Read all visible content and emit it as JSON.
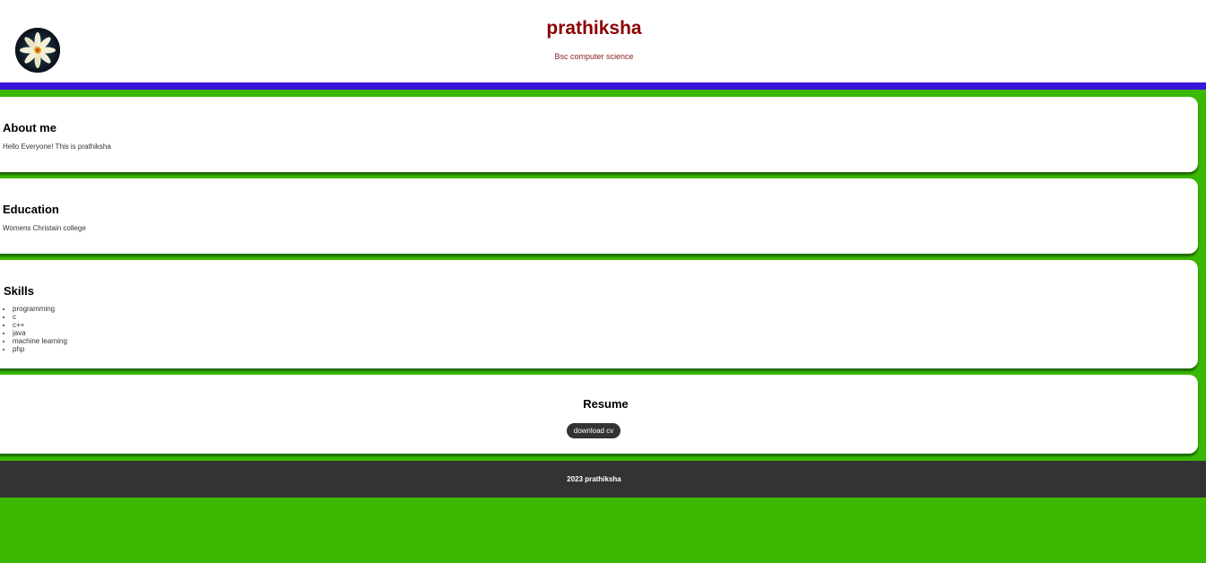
{
  "header": {
    "name": "prathiksha",
    "subtitle": "Bsc computer science",
    "avatar_icon": "white-lotus-flower-icon"
  },
  "sections": {
    "about": {
      "title": "About me",
      "text": "Hello Everyone! This is prathiksha"
    },
    "education": {
      "title": "Education",
      "text": "Womens Christain college"
    },
    "skills": {
      "title": "Skills",
      "items": [
        "programming",
        "c",
        "c++",
        "java",
        "machine learning",
        "php"
      ]
    },
    "resume": {
      "title": "Resume",
      "button_label": "download cv"
    }
  },
  "footer": {
    "text": "2023 prathiksha"
  },
  "colors": {
    "page_background": "#3bb800",
    "nav_bar": "#3a14d8",
    "title": "#8b0000",
    "footer_background": "#333333",
    "button_background": "#333333"
  }
}
